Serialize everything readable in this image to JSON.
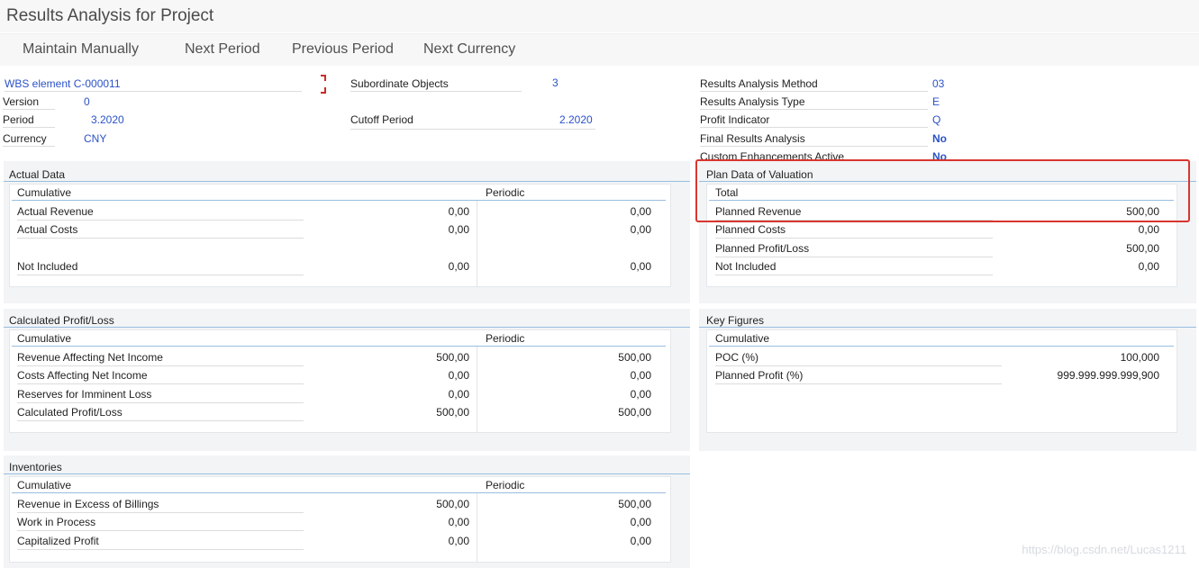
{
  "title": "Results Analysis for Project",
  "toolbar": {
    "maintain_manually": "Maintain Manually",
    "next_period": "Next Period",
    "previous_period": "Previous Period",
    "next_currency": "Next Currency"
  },
  "header": {
    "wbs_element": "WBS element C-000011",
    "version_label": "Version",
    "version_value": "0",
    "period_label": "Period",
    "period_value": "3.2020",
    "currency_label": "Currency",
    "currency_value": "CNY",
    "subordinate_objects_label": "Subordinate Objects",
    "subordinate_objects_value": "3",
    "cutoff_period_label": "Cutoff Period",
    "cutoff_period_value": "2.2020",
    "ra_method_label": "Results Analysis Method",
    "ra_method_value": "03",
    "ra_type_label": "Results Analysis Type",
    "ra_type_value": "E",
    "profit_indicator_label": "Profit Indicator",
    "profit_indicator_value": "Q",
    "final_ra_label": "Final Results Analysis",
    "final_ra_value": "No",
    "custom_enh_label": "Custom Enhancements Active",
    "custom_enh_value": "No"
  },
  "actual_data": {
    "title": "Actual Data",
    "col_cumulative": "Cumulative",
    "col_periodic": "Periodic",
    "rows": [
      {
        "label": "Actual Revenue",
        "cumulative": "0,00",
        "periodic": "0,00"
      },
      {
        "label": "Actual Costs",
        "cumulative": "0,00",
        "periodic": "0,00"
      },
      {
        "label": "Not Included",
        "cumulative": "0,00",
        "periodic": "0,00"
      }
    ]
  },
  "plan_data": {
    "title": "Plan Data of Valuation",
    "col_total": "Total",
    "rows": [
      {
        "label": "Planned Revenue",
        "total": "500,00"
      },
      {
        "label": "Planned Costs",
        "total": "0,00"
      },
      {
        "label": "Planned Profit/Loss",
        "total": "500,00"
      },
      {
        "label": "Not Included",
        "total": "0,00"
      }
    ]
  },
  "calculated_pl": {
    "title": "Calculated Profit/Loss",
    "col_cumulative": "Cumulative",
    "col_periodic": "Periodic",
    "rows": [
      {
        "label": "Revenue Affecting Net Income",
        "cumulative": "500,00",
        "periodic": "500,00"
      },
      {
        "label": "Costs Affecting Net Income",
        "cumulative": "0,00",
        "periodic": "0,00"
      },
      {
        "label": "Reserves for Imminent Loss",
        "cumulative": "0,00",
        "periodic": "0,00"
      },
      {
        "label": "Calculated Profit/Loss",
        "cumulative": "500,00",
        "periodic": "500,00"
      }
    ]
  },
  "key_figures": {
    "title": "Key Figures",
    "col_cumulative": "Cumulative",
    "rows": [
      {
        "label": "POC (%)",
        "cumulative": "100,000"
      },
      {
        "label": "Planned Profit (%)",
        "cumulative": "999.999.999.999,900"
      }
    ]
  },
  "inventories": {
    "title": "Inventories",
    "col_cumulative": "Cumulative",
    "col_periodic": "Periodic",
    "rows": [
      {
        "label": "Revenue in Excess of Billings",
        "cumulative": "500,00",
        "periodic": "500,00"
      },
      {
        "label": "Work in Process",
        "cumulative": "0,00",
        "periodic": "0,00"
      },
      {
        "label": "Capitalized Profit",
        "cumulative": "0,00",
        "periodic": "0,00"
      }
    ]
  },
  "watermark": "https://blog.csdn.net/Lucas1211",
  "colors": {
    "value_blue": "#2b52c8",
    "highlight_red": "#d9352e",
    "panel_bg": "#f2f4f6",
    "header_line": "#99bde0"
  }
}
